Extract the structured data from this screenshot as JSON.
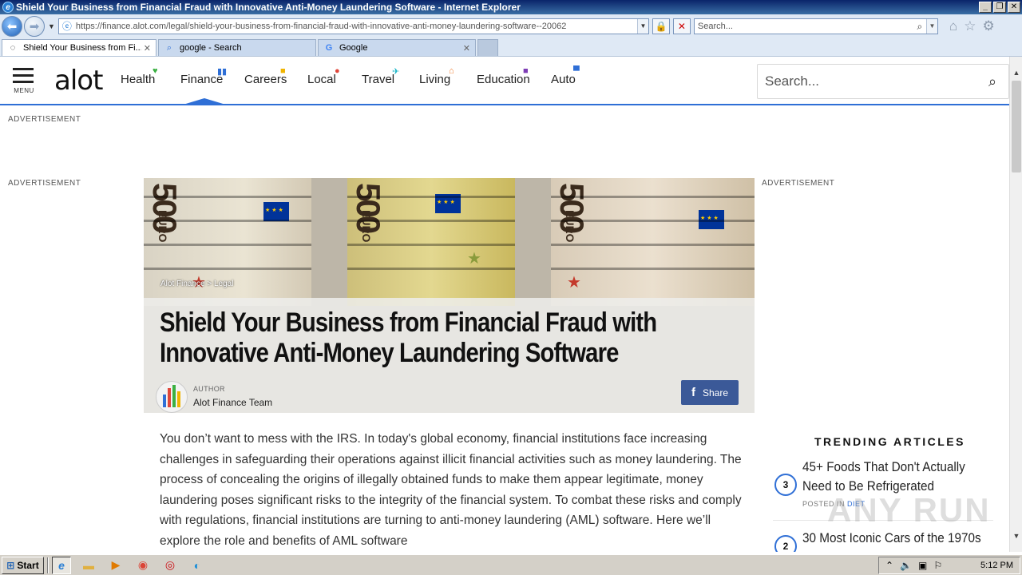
{
  "window": {
    "title": "Shield Your Business from Financial Fraud with Innovative Anti-Money Laundering Software - Internet Explorer",
    "controls": [
      "_",
      "❐",
      "✕"
    ]
  },
  "address_bar": {
    "url": "https://finance.alot.com/legal/shield-your-business-from-financial-fraud-with-innovative-anti-money-laundering-software--20062",
    "search_placeholder": "Search..."
  },
  "tabs": [
    {
      "label": "Shield Your Business from Fi...",
      "icon": "loading-icon",
      "active": true
    },
    {
      "label": "google - Search",
      "icon": "search-icon",
      "active": false
    },
    {
      "label": "Google",
      "icon": "google-icon",
      "active": false
    }
  ],
  "site": {
    "menu_label": "MENU",
    "logo": "alot",
    "nav": [
      {
        "label": "Health",
        "icon": "heart-icon",
        "icon_color": "#3cb043"
      },
      {
        "label": "Finance",
        "icon": "bar-chart-icon",
        "icon_color": "#2f6fd6"
      },
      {
        "label": "Careers",
        "icon": "briefcase-icon",
        "icon_color": "#f0b400"
      },
      {
        "label": "Local",
        "icon": "map-pin-icon",
        "icon_color": "#e0463a"
      },
      {
        "label": "Travel",
        "icon": "plane-icon",
        "icon_color": "#1fb7c9"
      },
      {
        "label": "Living",
        "icon": "house-icon",
        "icon_color": "#f07a2c"
      },
      {
        "label": "Education",
        "icon": "book-icon",
        "icon_color": "#7d3cb5"
      },
      {
        "label": "Auto",
        "icon": "car-icon",
        "icon_color": "#2f6fd6"
      }
    ],
    "search_placeholder": "Search...",
    "advertisement_label": "ADVERTISEMENT"
  },
  "article": {
    "breadcrumb": "Alot Finance > Legal",
    "headline": "Shield Your Business from Financial Fraud with Innovative Anti-Money Laundering Software",
    "author_label": "AUTHOR",
    "author_name": "Alot Finance Team",
    "share_label": "Share",
    "hero_note_denominations": [
      "500",
      "500",
      "500"
    ],
    "hero_note_currency": "EURO",
    "body": "You don’t want to mess with the IRS. In today's global economy, financial institutions face increasing challenges in safeguarding their operations against illicit financial activities such as money laundering. The process of concealing the origins of illegally obtained funds to make them appear legitimate, money laundering poses significant risks to the integrity of the financial system. To combat these risks and comply with regulations, financial institutions are turning to anti-money laundering (AML) software. Here we’ll explore the role and benefits of AML software"
  },
  "trending": {
    "title": "TRENDING ARTICLES",
    "items": [
      {
        "number": "3",
        "title": "45+ Foods That Don't Actually Need to Be Refrigerated",
        "posted_in": "POSTED IN",
        "category": "DIET"
      },
      {
        "number": "2",
        "title": "30 Most Iconic Cars of the 1970s"
      }
    ]
  },
  "watermark": "ANY RUN",
  "taskbar": {
    "start_label": "Start",
    "apps": [
      "ie-icon",
      "folder-icon",
      "media-player-icon",
      "chrome-icon",
      "opera-icon",
      "edge-icon"
    ],
    "clock": "5:12 PM"
  }
}
